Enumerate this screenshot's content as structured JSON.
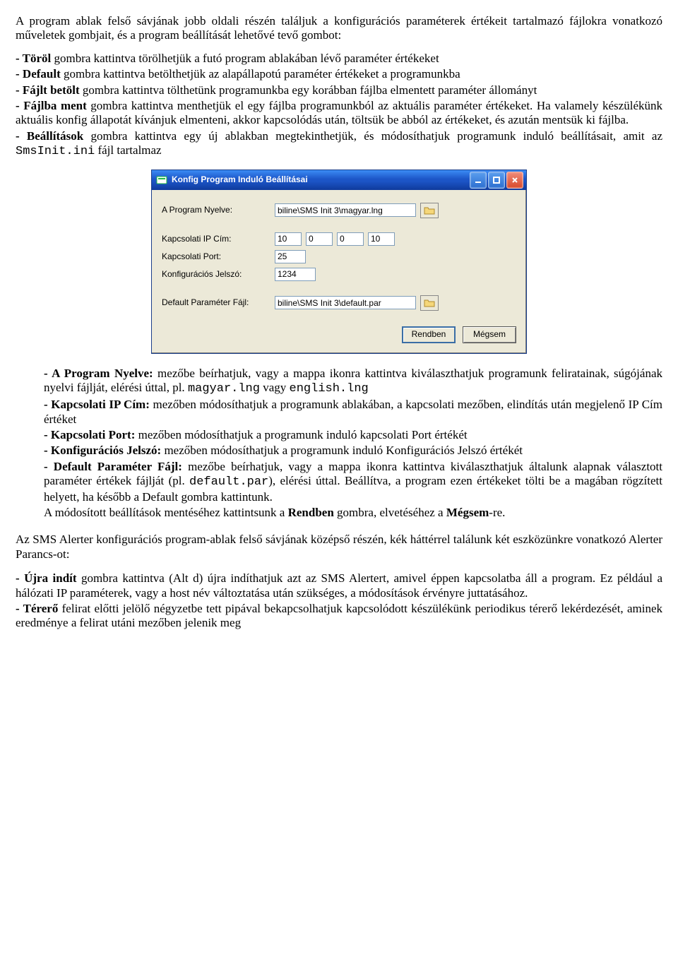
{
  "doc": {
    "intro": "A program ablak felső sávjának jobb oldali részén találjuk a konfigurációs paraméterek értékeit tartalmazó fájlokra vonatkozó műveletek gombjait, és a program beállítását lehetővé tevő gombot:",
    "bul1_lead": "- Töröl",
    "bul1_rest": " gombra kattintva törölhetjük a futó program ablakában lévő paraméter értékeket",
    "bul2_lead": "- Default",
    "bul2_rest": " gombra kattintva betölthetjük az alapállapotú paraméter értékeket a programunkba",
    "bul3_lead": "- Fájlt betölt",
    "bul3_rest": " gombra kattintva tölthetünk programunkba egy korábban fájlba elmentett paraméter állományt",
    "bul4_lead": "- Fájlba ment",
    "bul4_rest": " gombra kattintva menthetjük el egy fájlba programunkból az aktuális paraméter értékeket. Ha valamely készülékünk aktuális konfig állapotát kívánjuk elmenteni, akkor kapcsolódás után, töltsük be abból az értékeket, és azután mentsük ki fájlba.",
    "bul5_lead": "- Beállítások",
    "bul5_rest_a": " gombra kattintva egy új ablakban megtekinthetjük, és módosíthatjuk programunk induló beállításait, amit az ",
    "bul5_code": "SmsInit.ini",
    "bul5_rest_b": " fájl tartalmaz",
    "post1_lead": "- A Program Nyelve:",
    "post1_rest_a": " mezőbe beírhatjuk, vagy a mappa ikonra kattintva kiválaszthatjuk programunk feliratainak, súgójának nyelvi fájlját, elérési úttal, pl. ",
    "post1_code1": "magyar.lng",
    "post1_mid": " vagy ",
    "post1_code2": "english.lng",
    "post2_lead": "- Kapcsolati IP Cím:",
    "post2_rest": " mezőben módosíthatjuk a programunk ablakában, a kapcsolati mezőben, elindítás után megjelenő IP Cím értéket",
    "post3_lead": "- Kapcsolati Port:",
    "post3_rest": " mezőben módosíthatjuk a programunk induló kapcsolati Port értékét",
    "post4_lead": "- Konfigurációs Jelszó:",
    "post4_rest": " mezőben módosíthatjuk a programunk induló Konfigurációs Jelszó értékét",
    "post5_lead": "- Default Paraméter Fájl:",
    "post5_rest_a": " mezőbe beírhatjuk, vagy a mappa ikonra kattintva kiválaszthatjuk általunk alapnak választott paraméter értékek fájlját (pl. ",
    "post5_code": "default.par",
    "post5_rest_b": "), elérési úttal. Beállítva, a program ezen értékeket tölti be a magában rögzített helyett, ha később a Default gombra kattintunk.",
    "post6_a": "A módosított beállítások mentéséhez kattintsunk a ",
    "post6_b": "Rendben",
    "post6_c": " gombra, elvetéséhez a ",
    "post6_d": "Mégsem",
    "post6_e": "-re.",
    "mid_para": "Az SMS Alerter konfigurációs program-ablak felső sávjának középső részén, kék háttérrel találunk két eszközünkre vonatkozó Alerter Parancs-ot:",
    "end1_lead": "- Újra indít",
    "end1_rest": " gombra kattintva (Alt d) újra indíthatjuk azt az SMS Alertert, amivel éppen kapcsolatba áll a program. Ez például a hálózati IP paraméterek, vagy a host név változtatása után szükséges, a módosítások érvényre juttatásához.",
    "end2_lead": "- Térerő",
    "end2_rest": " felirat előtti jelölő négyzetbe tett pipával bekapcsolhatjuk kapcsolódott készülékünk periodikus térerő lekérdezését, aminek eredménye a felirat utáni mezőben jelenik meg"
  },
  "dialog": {
    "title": "Konfig Program Induló Beállításai",
    "labels": {
      "lang": "A Program Nyelve:",
      "ip": "Kapcsolati IP Cím:",
      "port": "Kapcsolati Port:",
      "pw": "Konfigurációs Jelszó:",
      "def": "Default Paraméter Fájl:"
    },
    "values": {
      "lang": "biline\\SMS Init 3\\magyar.lng",
      "ip": [
        "10",
        "0",
        "0",
        "10"
      ],
      "port": "25",
      "pw": "1234",
      "def": "biline\\SMS Init 3\\default.par"
    },
    "buttons": {
      "ok": "Rendben",
      "cancel": "Mégsem"
    }
  }
}
